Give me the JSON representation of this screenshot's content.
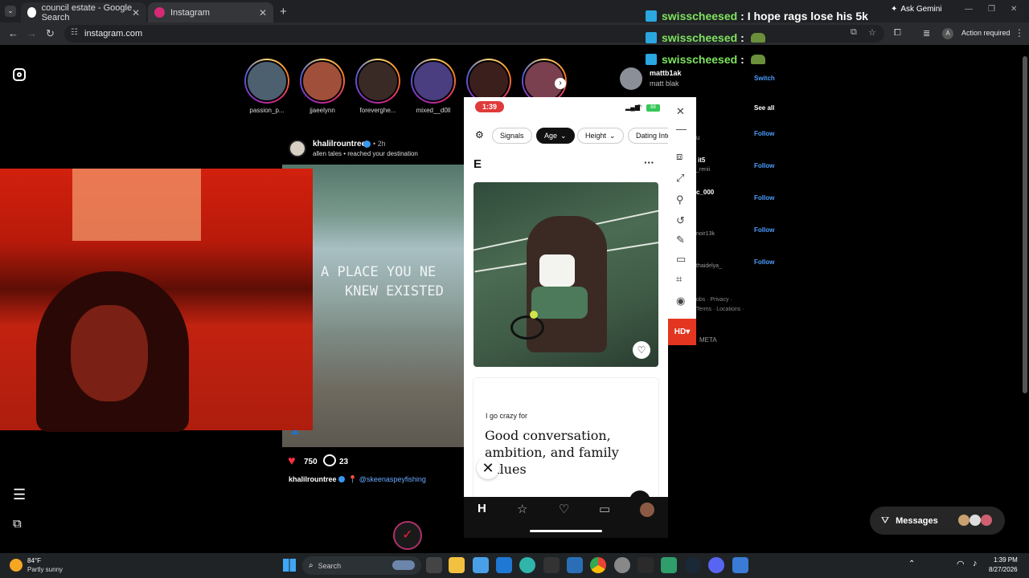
{
  "browser": {
    "tabs": [
      {
        "label": "council estate - Google Search",
        "color": "#ffffff"
      },
      {
        "label": "Instagram",
        "color": "#d62976"
      }
    ],
    "url": "instagram.com",
    "ask_gemini": "Ask Gemini",
    "action_required": "Action required",
    "profile_initial": "A"
  },
  "stories": [
    {
      "name": "passion_p...",
      "color": "#4c6070"
    },
    {
      "name": "jjaeelynn",
      "color": "#a0503a"
    },
    {
      "name": "foreverghe...",
      "color": "#3a2a25"
    },
    {
      "name": "mixed__d0ll",
      "color": "#4a3d80"
    },
    {
      "name": "",
      "color": "#3b1f1c"
    },
    {
      "name": "",
      "color": "#7a4050"
    }
  ],
  "chat_overlay": [
    {
      "user": "swisscheesed",
      "message": ": I hope rags lose his 5k"
    },
    {
      "user": "swisscheesed",
      "message": ":"
    },
    {
      "user": "swisscheesed",
      "message": ":"
    }
  ],
  "account": {
    "username": "mattb1ak",
    "display_name": "matt blak",
    "switch_label": "Switch"
  },
  "suggestions": {
    "see_all": "See all",
    "follow_label": "Follow",
    "names": [
      "u",
      "it5",
      "_renii",
      "c_000",
      "noir13k",
      "thaidelya_"
    ]
  },
  "footer_links": {
    "line1": "obs · Privacy ·",
    "line2": "Terms · Locations ·",
    "meta": "META"
  },
  "post": {
    "author": "khalilrountree",
    "time": "• 2h",
    "audio": "allen tales • reached your destination",
    "overlay_text_1": "A PLACE YOU NE",
    "overlay_text_2": "KNEW EXISTED",
    "likes": "750",
    "comments": "23",
    "caption_author": "khalilrountree",
    "caption_location": "📍 @skeenaspeyfishing"
  },
  "hinge": {
    "time": "1:39",
    "battery": "88",
    "filters": [
      "Signals",
      "Age",
      "Height",
      "Dating Inte"
    ],
    "name": "E",
    "prompt_label": "I go crazy for",
    "prompt_answer_1": "Good conversation,",
    "prompt_answer_2": "ambition, and family",
    "prompt_answer_3": "values"
  },
  "side_tools": {
    "hd_label": "HD"
  },
  "messages_label": "Messages",
  "taskbar": {
    "weather_temp": "84°F",
    "weather_desc": "Partly sunny",
    "search_placeholder": "Search",
    "time": "1:39 PM",
    "date": "8/27/2026"
  }
}
